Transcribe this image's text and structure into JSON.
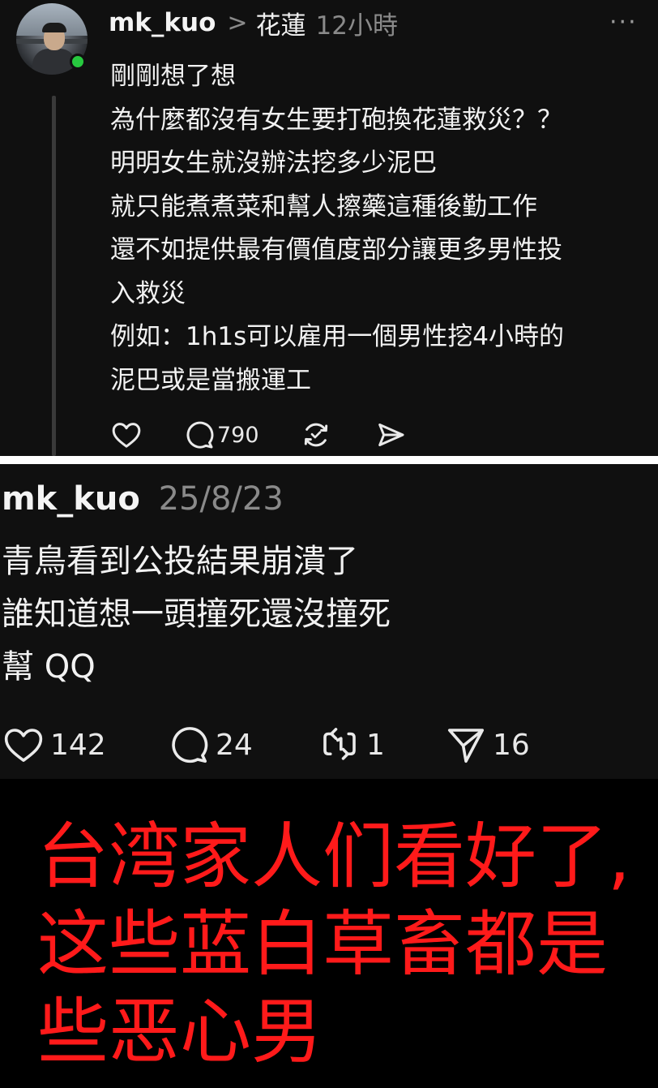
{
  "post1": {
    "username": "mk_kuo",
    "chevron": ">",
    "location": "花蓮",
    "time": "12小時",
    "more": "···",
    "lines": [
      "剛剛想了想",
      "為什麼都沒有女生要打砲換花蓮救災？？",
      "明明女生就沒辦法挖多少泥巴",
      "就只能煮煮菜和幫人擦藥這種後勤工作",
      "還不如提供最有價值度部分讓更多男性投",
      "入救災",
      "例如：1h1s可以雇用一個男性挖4小時的",
      "泥巴或是當搬運工"
    ],
    "actions": {
      "likes": "",
      "comments": "790",
      "reposts": "",
      "shares": ""
    }
  },
  "post2": {
    "username": "mk_kuo",
    "date": "25/8/23",
    "lines": [
      "青鳥看到公投結果崩潰了",
      "誰知道想一頭撞死還沒撞死",
      "幫 QQ"
    ],
    "actions": {
      "likes": "142",
      "comments": "24",
      "reposts": "1",
      "shares": "16"
    }
  },
  "caption": {
    "lines": [
      "台湾家人们看好了,",
      "这些蓝白草畜都是",
      "些恶心男"
    ],
    "color": "#ff1a1a"
  },
  "icons": {
    "like": "heart-icon",
    "comment": "comment-bubble-icon",
    "repost": "repost-icon",
    "share": "send-icon",
    "more": "more-options-icon",
    "chevron": "chevron-right-icon"
  }
}
